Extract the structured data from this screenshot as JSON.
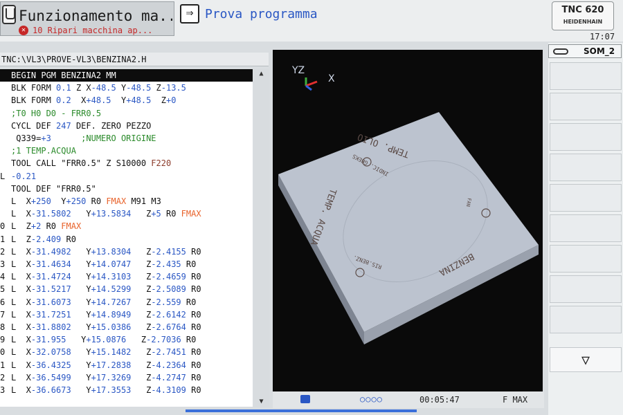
{
  "header": {
    "mode_title": "Funzionamento ma...",
    "error_message": "10 Ripari macchina ap...",
    "secondary_mode_title": "Prova programma",
    "control_model": "TNC 620",
    "control_brand": "HEIDENHAIN",
    "clock": "17:07"
  },
  "file_path": "TNC:\\VL3\\PROVE-VL3\\BENZINA2.H",
  "program_lines": [
    {
      "num": "",
      "parts": [
        {
          "t": "BEGIN PGM BENZINA2 MM",
          "cls": "white"
        }
      ]
    },
    {
      "num": "",
      "parts": [
        {
          "t": "BLK FORM "
        },
        {
          "t": "0.1",
          "cls": "blue"
        },
        {
          "t": " Z X"
        },
        {
          "t": "-48.5",
          "cls": "blue"
        },
        {
          "t": " Y"
        },
        {
          "t": "-48.5",
          "cls": "blue"
        },
        {
          "t": " Z"
        },
        {
          "t": "-13.5",
          "cls": "blue"
        }
      ]
    },
    {
      "num": "",
      "parts": [
        {
          "t": "BLK FORM "
        },
        {
          "t": "0.2",
          "cls": "blue"
        },
        {
          "t": "  X"
        },
        {
          "t": "+48.5",
          "cls": "blue"
        },
        {
          "t": "  Y"
        },
        {
          "t": "+48.5",
          "cls": "blue"
        },
        {
          "t": "  Z"
        },
        {
          "t": "+0",
          "cls": "blue"
        }
      ]
    },
    {
      "num": "",
      "parts": [
        {
          "t": ";T0 H0 D0 - FRR0.5",
          "cls": "green"
        }
      ]
    },
    {
      "num": "",
      "parts": [
        {
          "t": "CYCL DEF "
        },
        {
          "t": "247",
          "cls": "blue"
        },
        {
          "t": " DEF. ZERO PEZZO"
        }
      ]
    },
    {
      "num": "",
      "parts": [
        {
          "t": " Q339="
        },
        {
          "t": "+3",
          "cls": "blue"
        },
        {
          "t": "      ;NUMERO ORIGINE",
          "cls": "green"
        }
      ]
    },
    {
      "num": "",
      "parts": [
        {
          "t": ";1 TEMP.ACQUA",
          "cls": "green"
        }
      ]
    },
    {
      "num": "",
      "parts": [
        {
          "t": "TOOL CALL \"FRR0.5\" Z S10000 "
        },
        {
          "t": "F220",
          "cls": "brown"
        }
      ]
    },
    {
      "num": "L",
      "parts": [
        {
          "t": "-0.21",
          "cls": "blue"
        }
      ]
    },
    {
      "num": "",
      "parts": [
        {
          "t": "TOOL DEF \"FRR0.5\""
        }
      ]
    },
    {
      "num": "",
      "parts": [
        {
          "t": "L  X"
        },
        {
          "t": "+250",
          "cls": "blue"
        },
        {
          "t": "  Y"
        },
        {
          "t": "+250",
          "cls": "blue"
        },
        {
          "t": " R0 "
        },
        {
          "t": "FMAX",
          "cls": "orange"
        },
        {
          "t": " M91 M3"
        }
      ]
    },
    {
      "num": "",
      "parts": [
        {
          "t": "L  X"
        },
        {
          "t": "-31.5802",
          "cls": "blue"
        },
        {
          "t": "   Y"
        },
        {
          "t": "+13.5834",
          "cls": "blue"
        },
        {
          "t": "   Z"
        },
        {
          "t": "+5",
          "cls": "blue"
        },
        {
          "t": " R0 "
        },
        {
          "t": "FMAX",
          "cls": "orange"
        }
      ]
    },
    {
      "num": "0",
      "parts": [
        {
          "t": "L  Z"
        },
        {
          "t": "+2",
          "cls": "blue"
        },
        {
          "t": " R0 "
        },
        {
          "t": "FMAX",
          "cls": "orange"
        }
      ]
    },
    {
      "num": "1",
      "parts": [
        {
          "t": "L  Z"
        },
        {
          "t": "-2.409",
          "cls": "blue"
        },
        {
          "t": " R0"
        }
      ]
    },
    {
      "num": "2",
      "parts": [
        {
          "t": "L  X"
        },
        {
          "t": "-31.4982",
          "cls": "blue"
        },
        {
          "t": "   Y"
        },
        {
          "t": "+13.8304",
          "cls": "blue"
        },
        {
          "t": "   Z"
        },
        {
          "t": "-2.4155",
          "cls": "blue"
        },
        {
          "t": " R0"
        }
      ]
    },
    {
      "num": "3",
      "parts": [
        {
          "t": "L  X"
        },
        {
          "t": "-31.4634",
          "cls": "blue"
        },
        {
          "t": "   Y"
        },
        {
          "t": "+14.0747",
          "cls": "blue"
        },
        {
          "t": "   Z"
        },
        {
          "t": "-2.435",
          "cls": "blue"
        },
        {
          "t": " R0"
        }
      ]
    },
    {
      "num": "4",
      "parts": [
        {
          "t": "L  X"
        },
        {
          "t": "-31.4724",
          "cls": "blue"
        },
        {
          "t": "   Y"
        },
        {
          "t": "+14.3103",
          "cls": "blue"
        },
        {
          "t": "   Z"
        },
        {
          "t": "-2.4659",
          "cls": "blue"
        },
        {
          "t": " R0"
        }
      ]
    },
    {
      "num": "5",
      "parts": [
        {
          "t": "L  X"
        },
        {
          "t": "-31.5217",
          "cls": "blue"
        },
        {
          "t": "   Y"
        },
        {
          "t": "+14.5299",
          "cls": "blue"
        },
        {
          "t": "   Z"
        },
        {
          "t": "-2.5089",
          "cls": "blue"
        },
        {
          "t": " R0"
        }
      ]
    },
    {
      "num": "6",
      "parts": [
        {
          "t": "L  X"
        },
        {
          "t": "-31.6073",
          "cls": "blue"
        },
        {
          "t": "   Y"
        },
        {
          "t": "+14.7267",
          "cls": "blue"
        },
        {
          "t": "   Z"
        },
        {
          "t": "-2.559",
          "cls": "blue"
        },
        {
          "t": " R0"
        }
      ]
    },
    {
      "num": "7",
      "parts": [
        {
          "t": "L  X"
        },
        {
          "t": "-31.7251",
          "cls": "blue"
        },
        {
          "t": "   Y"
        },
        {
          "t": "+14.8949",
          "cls": "blue"
        },
        {
          "t": "   Z"
        },
        {
          "t": "-2.6142",
          "cls": "blue"
        },
        {
          "t": " R0"
        }
      ]
    },
    {
      "num": "8",
      "parts": [
        {
          "t": "L  X"
        },
        {
          "t": "-31.8802",
          "cls": "blue"
        },
        {
          "t": "   Y"
        },
        {
          "t": "+15.0386",
          "cls": "blue"
        },
        {
          "t": "   Z"
        },
        {
          "t": "-2.6764",
          "cls": "blue"
        },
        {
          "t": " R0"
        }
      ]
    },
    {
      "num": "9",
      "parts": [
        {
          "t": "L  X"
        },
        {
          "t": "-31.955",
          "cls": "blue"
        },
        {
          "t": "   Y"
        },
        {
          "t": "+15.0876",
          "cls": "blue"
        },
        {
          "t": "   Z"
        },
        {
          "t": "-2.7036",
          "cls": "blue"
        },
        {
          "t": " R0"
        }
      ]
    },
    {
      "num": "0",
      "parts": [
        {
          "t": "L  X"
        },
        {
          "t": "-32.0758",
          "cls": "blue"
        },
        {
          "t": "   Y"
        },
        {
          "t": "+15.1482",
          "cls": "blue"
        },
        {
          "t": "   Z"
        },
        {
          "t": "-2.7451",
          "cls": "blue"
        },
        {
          "t": " R0"
        }
      ]
    },
    {
      "num": "1",
      "parts": [
        {
          "t": "L  X"
        },
        {
          "t": "-36.4325",
          "cls": "blue"
        },
        {
          "t": "   Y"
        },
        {
          "t": "+17.2838",
          "cls": "blue"
        },
        {
          "t": "   Z"
        },
        {
          "t": "-4.2364",
          "cls": "blue"
        },
        {
          "t": " R0"
        }
      ]
    },
    {
      "num": "2",
      "parts": [
        {
          "t": "L  X"
        },
        {
          "t": "-36.5499",
          "cls": "blue"
        },
        {
          "t": "   Y"
        },
        {
          "t": "+17.3269",
          "cls": "blue"
        },
        {
          "t": "   Z"
        },
        {
          "t": "-4.2747",
          "cls": "blue"
        },
        {
          "t": " R0"
        }
      ]
    },
    {
      "num": "3",
      "parts": [
        {
          "t": "L  X"
        },
        {
          "t": "-36.6673",
          "cls": "blue"
        },
        {
          "t": "   Y"
        },
        {
          "t": "+17.3553",
          "cls": "blue"
        },
        {
          "t": "   Z"
        },
        {
          "t": "-4.3109",
          "cls": "blue"
        },
        {
          "t": " R0"
        }
      ]
    }
  ],
  "graphics": {
    "axis_label_yz": "YZ",
    "axis_label_x": "X",
    "engravings": {
      "temp_olio": "TEMP. OLIO",
      "indic_gbeks": "INDIC. GBEKS",
      "temp_acqua": "TEMP. ACQUA",
      "ris_benz": "RIS.BENZ.",
      "benzina": "BENZINA",
      "fan": "FAN"
    }
  },
  "status": {
    "progress_dots": "○○○○",
    "elapsed_time": "00:05:47",
    "feed_mode": "F MAX"
  },
  "sidebar": {
    "user_label": "SOM_2",
    "down_arrow": "▽"
  },
  "colors": {
    "code_blue": "#2a57c4",
    "comment_green": "#2a8a2a",
    "fmax_orange": "#e8622a",
    "error_red": "#c62828",
    "workpiece_top": "#b9c0cc",
    "workpiece_side": "#8c93a0"
  }
}
